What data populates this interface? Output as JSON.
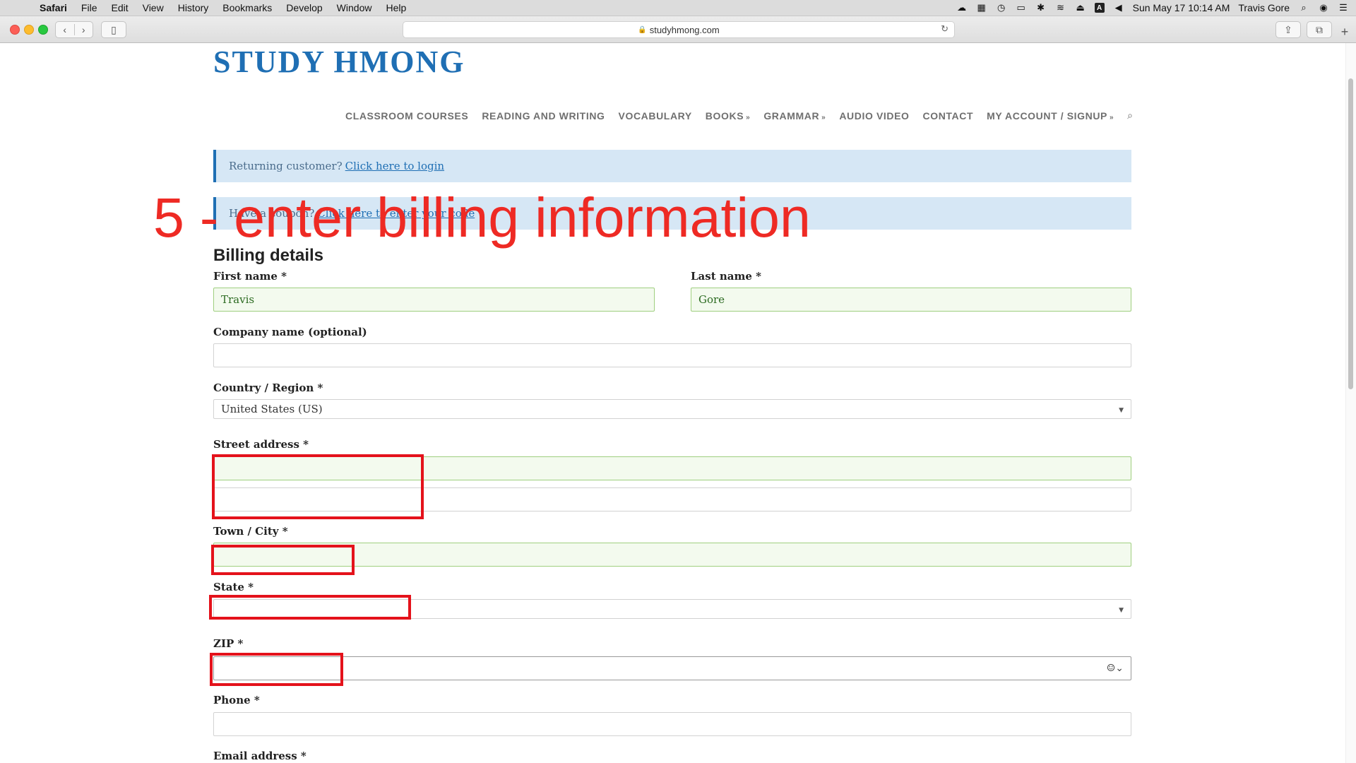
{
  "menubar": {
    "app": "Safari",
    "items": [
      "File",
      "Edit",
      "View",
      "History",
      "Bookmarks",
      "Develop",
      "Window",
      "Help"
    ],
    "datetime": "Sun May 17  10:14 AM",
    "user": "Travis Gore"
  },
  "browser": {
    "url": "studyhmong.com"
  },
  "site": {
    "logo": "STUDY HMONG",
    "nav": [
      "CLASSROOM COURSES",
      "READING AND WRITING",
      "VOCABULARY",
      "BOOKS",
      "GRAMMAR",
      "AUDIO VIDEO",
      "CONTACT",
      "MY ACCOUNT / SIGNUP"
    ]
  },
  "notices": {
    "login_text": "Returning customer?",
    "login_link": "Click here to login",
    "coupon_text": "Have a coupon?",
    "coupon_link": "Click here to enter your code"
  },
  "overlay_caption": "5 - enter billing information",
  "billing": {
    "title": "Billing details",
    "first_name_label": "First name *",
    "first_name_value": "Travis",
    "last_name_label": "Last name *",
    "last_name_value": "Gore",
    "company_label": "Company name (optional)",
    "company_value": "",
    "country_label": "Country / Region *",
    "country_value": "United States (US)",
    "street_label": "Street address *",
    "street_value_1": "",
    "street_value_2": "",
    "city_label": "Town / City *",
    "city_value": "",
    "state_label": "State *",
    "state_value": "",
    "zip_label": "ZIP *",
    "zip_value": "",
    "phone_label": "Phone *",
    "phone_value": "",
    "email_label": "Email address *"
  }
}
